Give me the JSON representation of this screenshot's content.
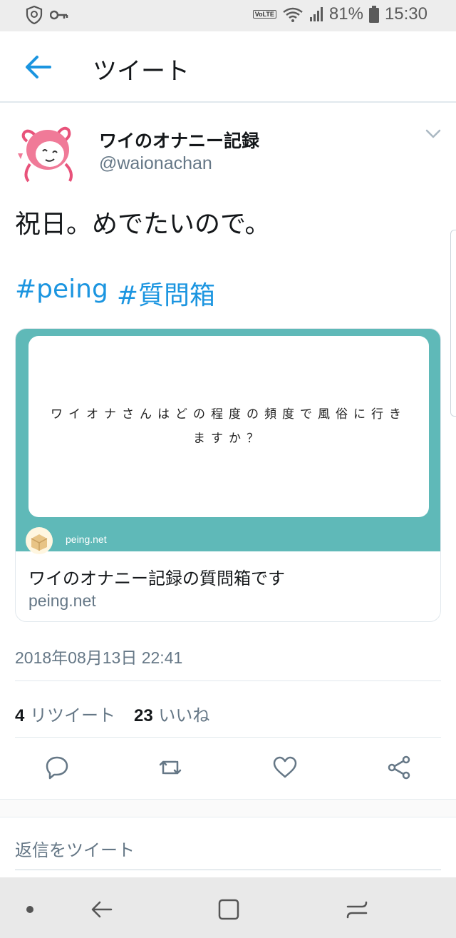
{
  "status_bar": {
    "battery": "81%",
    "time": "15:30",
    "network_badge": "VoLTE",
    "icons": [
      "shield-icon",
      "key-icon",
      "wifi-icon",
      "signal-icon",
      "battery-icon"
    ]
  },
  "app_bar": {
    "title": "ツイート",
    "icons": [
      "back-arrow-icon"
    ]
  },
  "tweet": {
    "author_name": "ワイのオナニー記録",
    "author_handle": "@waionachan",
    "text": "祝日。めでたいので。",
    "hashtags": [
      "#peing",
      "#質問箱"
    ],
    "timestamp": "2018年08月13日 22:41"
  },
  "card": {
    "question": "ワイオナさんはどの程度の頻度で風俗に行きますか？",
    "site": "peing.net",
    "title": "ワイのオナニー記録の質問箱です",
    "domain": "peing.net"
  },
  "stats": {
    "retweet_count": "4",
    "retweet_label": "リツイート",
    "like_count": "23",
    "like_label": "いいね"
  },
  "actions": [
    "reply-icon",
    "retweet-icon",
    "like-icon",
    "share-icon"
  ],
  "reply": {
    "placeholder": "返信をツイート"
  },
  "nav_bar": [
    "dot-icon",
    "back-icon",
    "home-icon",
    "recents-icon"
  ],
  "colors": {
    "accent": "#1b95e0",
    "secondary_text": "#657786",
    "card_teal": "#5fb9b8",
    "status_bar_bg": "#ededed"
  }
}
